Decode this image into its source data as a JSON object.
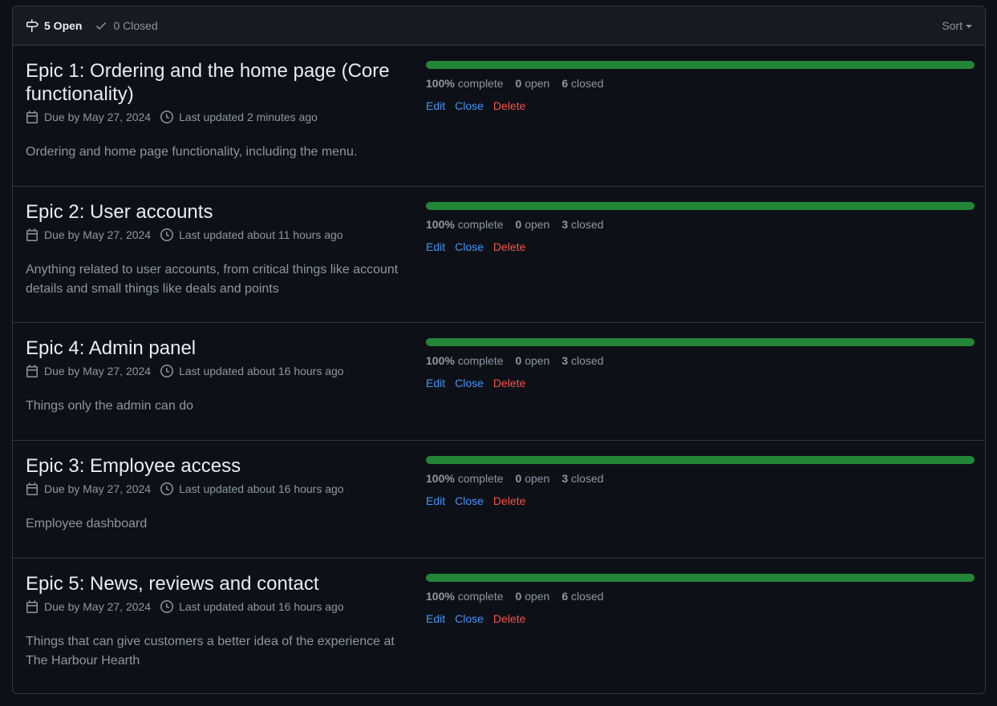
{
  "header": {
    "open_label": "5 Open",
    "closed_label": "0 Closed",
    "sort_label": "Sort"
  },
  "milestones": [
    {
      "title": "Epic 1: Ordering and the home page (Core functionality)",
      "due": "Due by May 27, 2024",
      "updated": "Last updated 2 minutes ago",
      "description": "Ordering and home page functionality, including the menu.",
      "progress": 100,
      "percent_num": "100%",
      "percent_label": "complete",
      "open_num": "0",
      "open_label": "open",
      "closed_num": "6",
      "closed_label": "closed"
    },
    {
      "title": "Epic 2: User accounts",
      "due": "Due by May 27, 2024",
      "updated": "Last updated about 11 hours ago",
      "description": "Anything related to user accounts, from critical things like account details and small things like deals and points",
      "progress": 100,
      "percent_num": "100%",
      "percent_label": "complete",
      "open_num": "0",
      "open_label": "open",
      "closed_num": "3",
      "closed_label": "closed"
    },
    {
      "title": "Epic 4: Admin panel",
      "due": "Due by May 27, 2024",
      "updated": "Last updated about 16 hours ago",
      "description": "Things only the admin can do",
      "progress": 100,
      "percent_num": "100%",
      "percent_label": "complete",
      "open_num": "0",
      "open_label": "open",
      "closed_num": "3",
      "closed_label": "closed"
    },
    {
      "title": "Epic 3: Employee access",
      "due": "Due by May 27, 2024",
      "updated": "Last updated about 16 hours ago",
      "description": "Employee dashboard",
      "progress": 100,
      "percent_num": "100%",
      "percent_label": "complete",
      "open_num": "0",
      "open_label": "open",
      "closed_num": "3",
      "closed_label": "closed"
    },
    {
      "title": "Epic 5: News, reviews and contact",
      "due": "Due by May 27, 2024",
      "updated": "Last updated about 16 hours ago",
      "description": "Things that can give customers a better idea of the experience at The Harbour Hearth",
      "progress": 100,
      "percent_num": "100%",
      "percent_label": "complete",
      "open_num": "0",
      "open_label": "open",
      "closed_num": "6",
      "closed_label": "closed"
    }
  ],
  "actions": {
    "edit": "Edit",
    "close": "Close",
    "delete": "Delete"
  },
  "colors": {
    "progress": "#238636",
    "link": "#4493f8",
    "danger": "#f85149"
  },
  "icons": {
    "open": "milestone-icon",
    "closed": "check-icon",
    "due": "calendar-icon",
    "updated": "clock-icon"
  }
}
